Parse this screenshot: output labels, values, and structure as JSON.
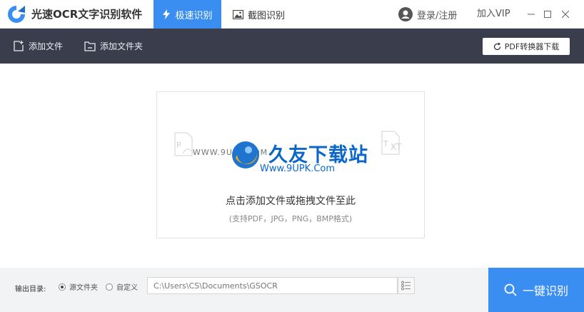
{
  "app": {
    "title": "光速OCR文字识别软件"
  },
  "tabs": [
    {
      "label": "极速识别",
      "active": true
    },
    {
      "label": "截图识别",
      "active": false
    }
  ],
  "header": {
    "login_label": "登录/注册",
    "vip_label": "加入VIP"
  },
  "toolbar": {
    "add_file_label": "添加文件",
    "add_folder_label": "添加文件夹",
    "pdf_converter_label": "PDF转换器下载"
  },
  "dropzone": {
    "main_text": "点击添加文件或拖拽文件至此",
    "sub_text": "(支持PDF，JPG，PNG，BMP格式)",
    "icons": [
      "pdf-file-icon",
      "txt-file-icon"
    ]
  },
  "watermark": {
    "brand": "久友下载站",
    "url": "Www.9UPK.Com",
    "side_text": "WWW.9UPK.COM"
  },
  "output": {
    "label": "输出目录:",
    "options": [
      {
        "label": "源文件夹",
        "selected": true
      },
      {
        "label": "自定义",
        "selected": false
      }
    ],
    "path_placeholder": "C:\\Users\\CS\\Documents\\GSOCR"
  },
  "action": {
    "ocr_label": "一键识别"
  },
  "colors": {
    "accent": "#3a8ef2",
    "toolbar_bg": "#3a3e4c",
    "bottom_bg": "#f2f3f5"
  }
}
